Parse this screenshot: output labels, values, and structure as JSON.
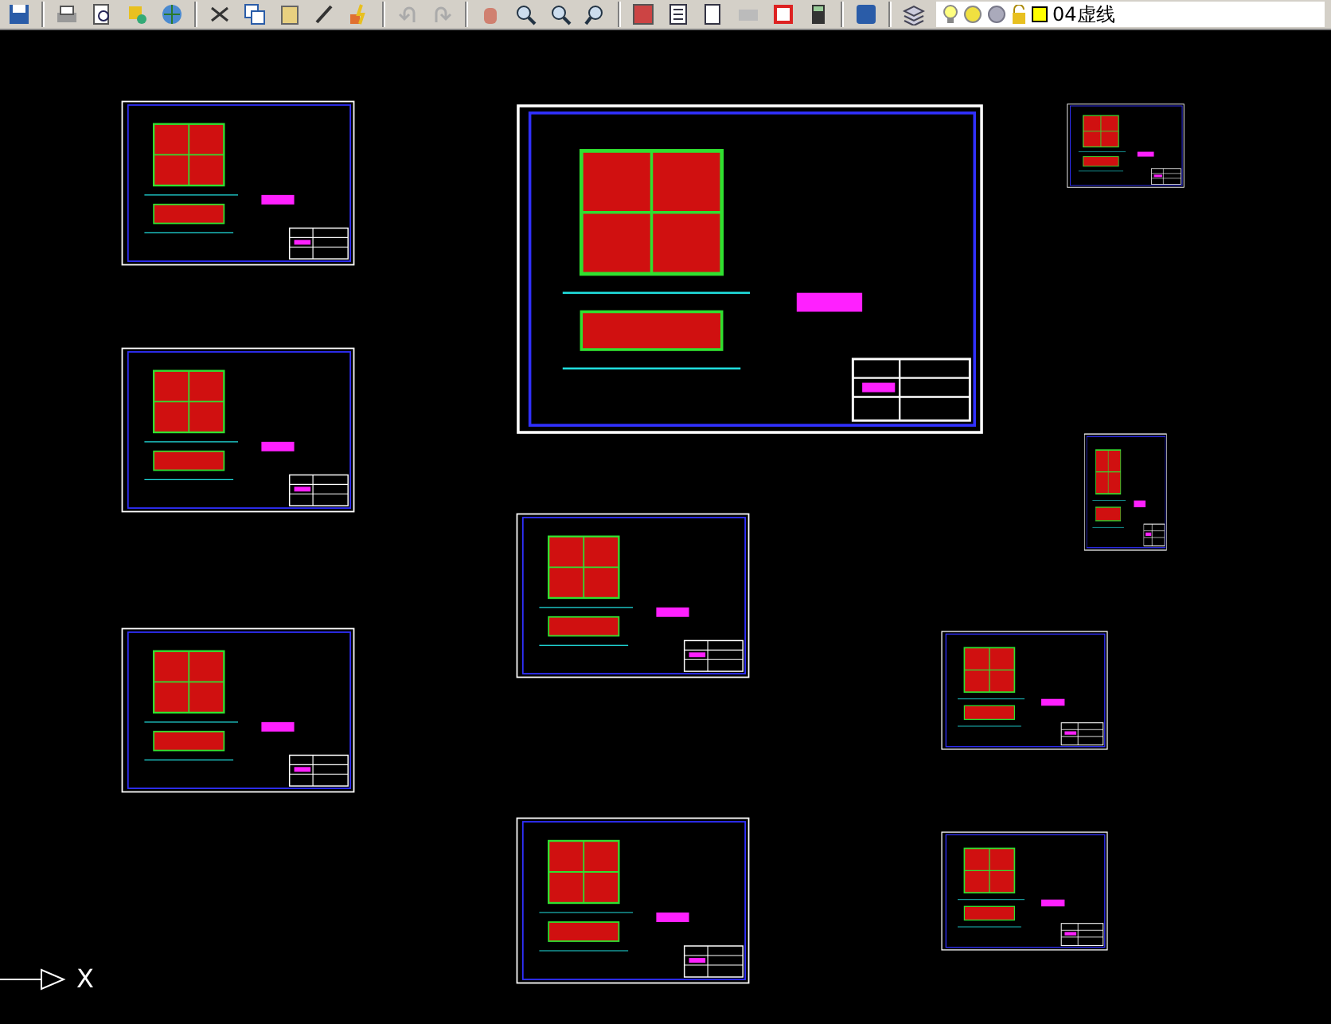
{
  "toolbar": {
    "layer_name": "04虚线"
  },
  "ucs": {
    "x_label": "X"
  }
}
